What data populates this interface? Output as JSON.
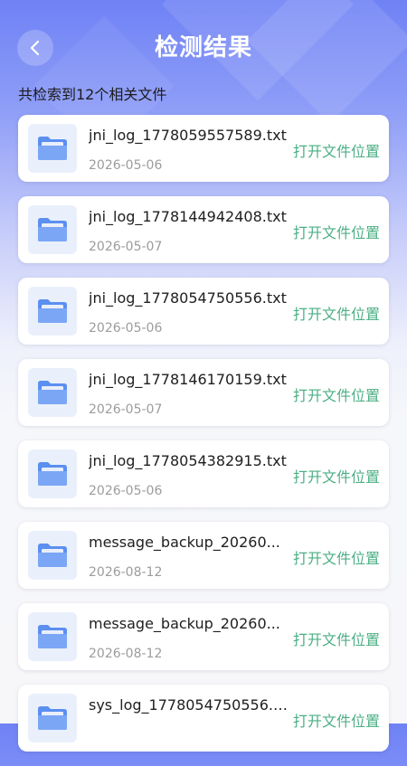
{
  "header": {
    "title": "检测结果",
    "back_icon": "chevron-left-icon"
  },
  "summary": "共检索到12个相关文件",
  "colors": {
    "header_gradient_top": "#6f82f5",
    "accent_green": "#4caf85",
    "folder_blue": "#5b8ff0"
  },
  "files": [
    {
      "name": "jni_log_1778059557589.txt",
      "date": "2026-05-06",
      "action": "打开文件位置",
      "icon": "folder-icon"
    },
    {
      "name": "jni_log_1778144942408.txt",
      "date": "2026-05-07",
      "action": "打开文件位置",
      "icon": "folder-icon"
    },
    {
      "name": "jni_log_1778054750556.txt",
      "date": "2026-05-06",
      "action": "打开文件位置",
      "icon": "folder-icon"
    },
    {
      "name": "jni_log_1778146170159.txt",
      "date": "2026-05-07",
      "action": "打开文件位置",
      "icon": "folder-icon"
    },
    {
      "name": "jni_log_1778054382915.txt",
      "date": "2026-05-06",
      "action": "打开文件位置",
      "icon": "folder-icon"
    },
    {
      "name": "message_backup_20260...",
      "date": "2026-08-12",
      "action": "打开文件位置",
      "icon": "folder-icon"
    },
    {
      "name": "message_backup_20260...",
      "date": "2026-08-12",
      "action": "打开文件位置",
      "icon": "folder-icon"
    },
    {
      "name": "sys_log_1778054750556.txt",
      "date": "",
      "action": "打开文件位置",
      "icon": "folder-icon"
    }
  ]
}
